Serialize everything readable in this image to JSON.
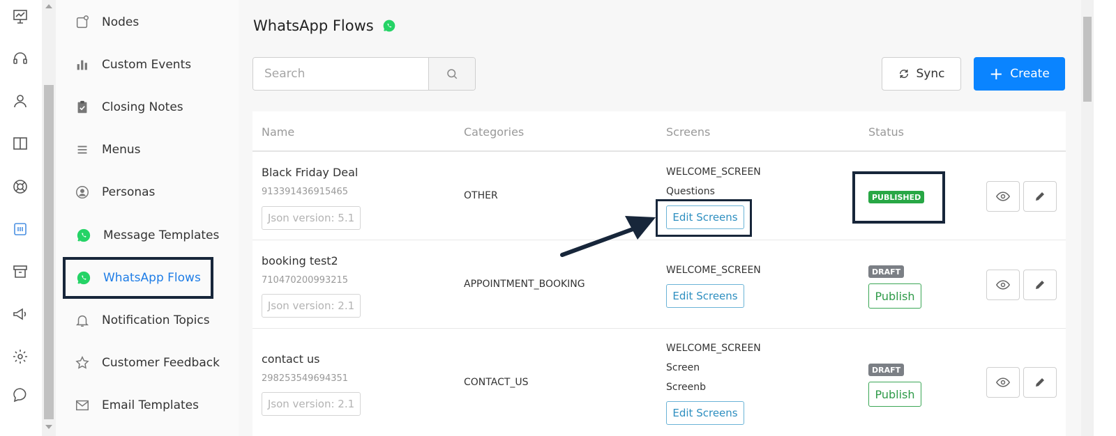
{
  "rail": {
    "icons": [
      "presentation-icon",
      "headset-icon",
      "user-icon",
      "columns-icon",
      "lifebuoy-icon",
      "channel-icon",
      "archive-icon",
      "megaphone-icon",
      "gear-icon",
      "chat-icon"
    ]
  },
  "menu": {
    "items": [
      {
        "label": "Nodes",
        "icon": "node-icon"
      },
      {
        "label": "Custom Events",
        "icon": "bar-chart-icon"
      },
      {
        "label": "Closing Notes",
        "icon": "clipboard-check-icon"
      },
      {
        "label": "Menus",
        "icon": "list-icon"
      },
      {
        "label": "Personas",
        "icon": "person-circle-icon"
      },
      {
        "label": "Message Templates",
        "icon": "whatsapp-icon"
      },
      {
        "label": "WhatsApp Flows",
        "icon": "whatsapp-icon",
        "active": true
      },
      {
        "label": "Notification Topics",
        "icon": "bell-icon"
      },
      {
        "label": "Customer Feedback",
        "icon": "star-icon"
      },
      {
        "label": "Email Templates",
        "icon": "mail-icon"
      }
    ]
  },
  "page": {
    "title": "WhatsApp Flows",
    "search_placeholder": "Search",
    "sync_label": "Sync",
    "create_label": "Create"
  },
  "table": {
    "headers": [
      "Name",
      "Categories",
      "Screens",
      "Status"
    ],
    "rows": [
      {
        "name": "Black Friday Deal",
        "id": "913391436915465",
        "json_version": "Json version: 5.1",
        "category": "OTHER",
        "screens": [
          "WELCOME_SCREEN",
          "Questions"
        ],
        "edit_label": "Edit Screens",
        "status": "PUBLISHED"
      },
      {
        "name": "booking test2",
        "id": "710470200993215",
        "json_version": "Json version: 2.1",
        "category": "APPOINTMENT_BOOKING",
        "screens": [
          "WELCOME_SCREEN"
        ],
        "edit_label": "Edit Screens",
        "status": "DRAFT",
        "publish_label": "Publish"
      },
      {
        "name": "contact us",
        "id": "298253549694351",
        "json_version": "Json version: 2.1",
        "category": "CONTACT_US",
        "screens": [
          "WELCOME_SCREEN",
          "Screen",
          "Screenb"
        ],
        "edit_label": "Edit Screens",
        "status": "DRAFT",
        "publish_label": "Publish"
      }
    ]
  },
  "colors": {
    "primary": "#0a84ff",
    "active_menu": "#1f7de6",
    "published": "#28a745",
    "draft": "#7b7f85",
    "whatsapp": "#25d366",
    "annotation": "#17263a"
  }
}
